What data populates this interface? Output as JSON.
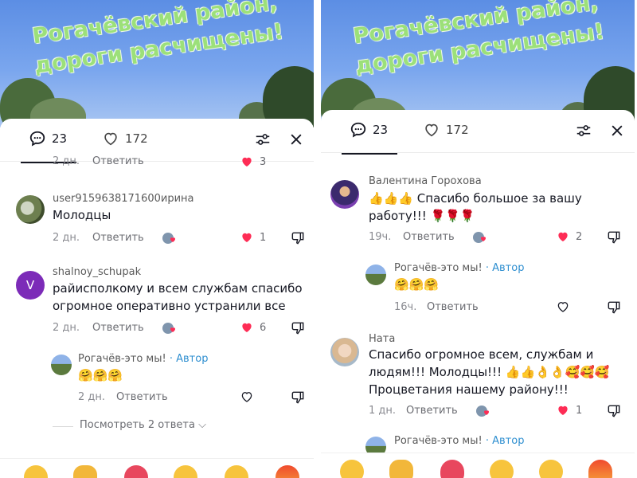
{
  "banner": {
    "title": "Рогачёвский район,\nдороги расчищены!"
  },
  "left": {
    "tabs": {
      "comments_count": "23",
      "likes_count": "172"
    },
    "top_partial": {
      "time": "2 дн.",
      "reply": "Ответить",
      "likes": "3"
    },
    "comments": [
      {
        "user": "user9159638171600ирина",
        "text": "Молодцы",
        "time": "2 дн.",
        "reply": "Ответить",
        "likes": "1"
      },
      {
        "user": "shalnoy_schupak",
        "avatar_letter": "V",
        "text": "райисполкому и всем службам спасибо\nогромное оперативно устранили все",
        "time": "2 дн.",
        "reply": "Ответить",
        "likes": "6"
      }
    ],
    "author_reply": {
      "user": "Рогачёв-это мы!",
      "badge": "· Автор",
      "text": "🤗🤗🤗",
      "time": "2 дн.",
      "reply": "Ответить"
    },
    "more_replies": "Посмотреть 2 ответа ⌵"
  },
  "right": {
    "tabs": {
      "comments_count": "23",
      "likes_count": "172"
    },
    "comments": [
      {
        "user": "Валентина Горохова",
        "text": "👍👍👍 Спасибо большое за вашу\nработу!!! 🌹🌹🌹",
        "time": "19ч.",
        "reply": "Ответить",
        "likes": "2"
      },
      {
        "user": "Ната",
        "text": "Спасибо огромное всем, службам и\nлюдям!!! Молодцы!!! 👍👍👌👌🥰🥰🥰\nПроцветания нашему району!!!",
        "time": "1 дн.",
        "reply": "Ответить",
        "likes": "1"
      }
    ],
    "author_reply": {
      "user": "Рогачёв-это мы!",
      "badge": "· Автор",
      "text": "🤗🤗🤗",
      "time": "16ч.",
      "reply": "Ответить"
    },
    "author_reply_partial": {
      "user": "Рогачёв-это мы!",
      "badge": "· Автор"
    }
  },
  "colors": {
    "like_red": "#fe2c55",
    "author_blue": "#2f8fd0",
    "banner_text": "#9ce07a"
  }
}
